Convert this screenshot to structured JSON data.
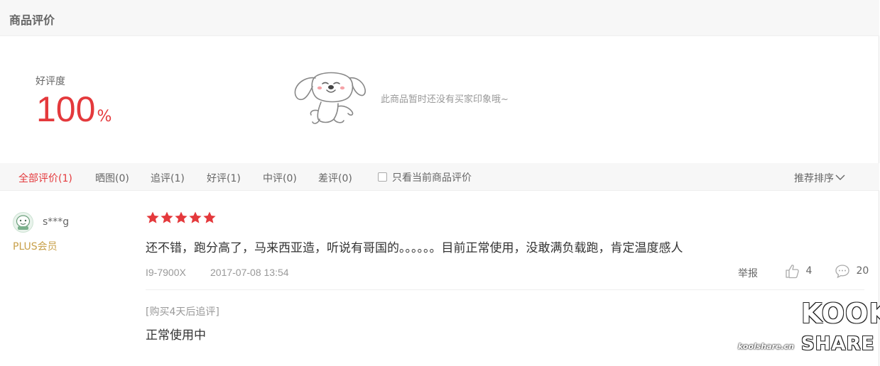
{
  "header": {
    "title": "商品评价"
  },
  "rating": {
    "label": "好评度",
    "value": "100",
    "unit": "%"
  },
  "empty_state": {
    "mascot_icon": "jd-dog-mascot-icon",
    "text": "此商品暂时还没有买家印象哦~"
  },
  "tabs": [
    {
      "label": "全部评价(1)",
      "active": true
    },
    {
      "label": "晒图(0)"
    },
    {
      "label": "追评(1)"
    },
    {
      "label": "好评(1)"
    },
    {
      "label": "中评(0)"
    },
    {
      "label": "差评(0)"
    }
  ],
  "filter": {
    "only_current_label": "只看当前商品评价",
    "checked": false
  },
  "sort": {
    "label": "推荐排序"
  },
  "review": {
    "user": "s***g",
    "member": "PLUS会员",
    "stars": 5,
    "text": "还不错，跑分高了，马来西亚造，听说有哥国的。。。。。。目前正常使用，没敢满负载跑，肯定温度感人",
    "product": "I9-7900X",
    "date": "2017-07-08 13:54",
    "report_label": "举报",
    "likes": "4",
    "comments": "20",
    "followup": {
      "label": "[购买4天后追评]",
      "text": "正常使用中"
    }
  },
  "watermark": {
    "top": "KOOK",
    "bottom": "SHARE",
    "site": "koolshare.cn"
  },
  "colors": {
    "accent": "#e4393c",
    "plus": "#c8a04a",
    "muted": "#999999"
  }
}
